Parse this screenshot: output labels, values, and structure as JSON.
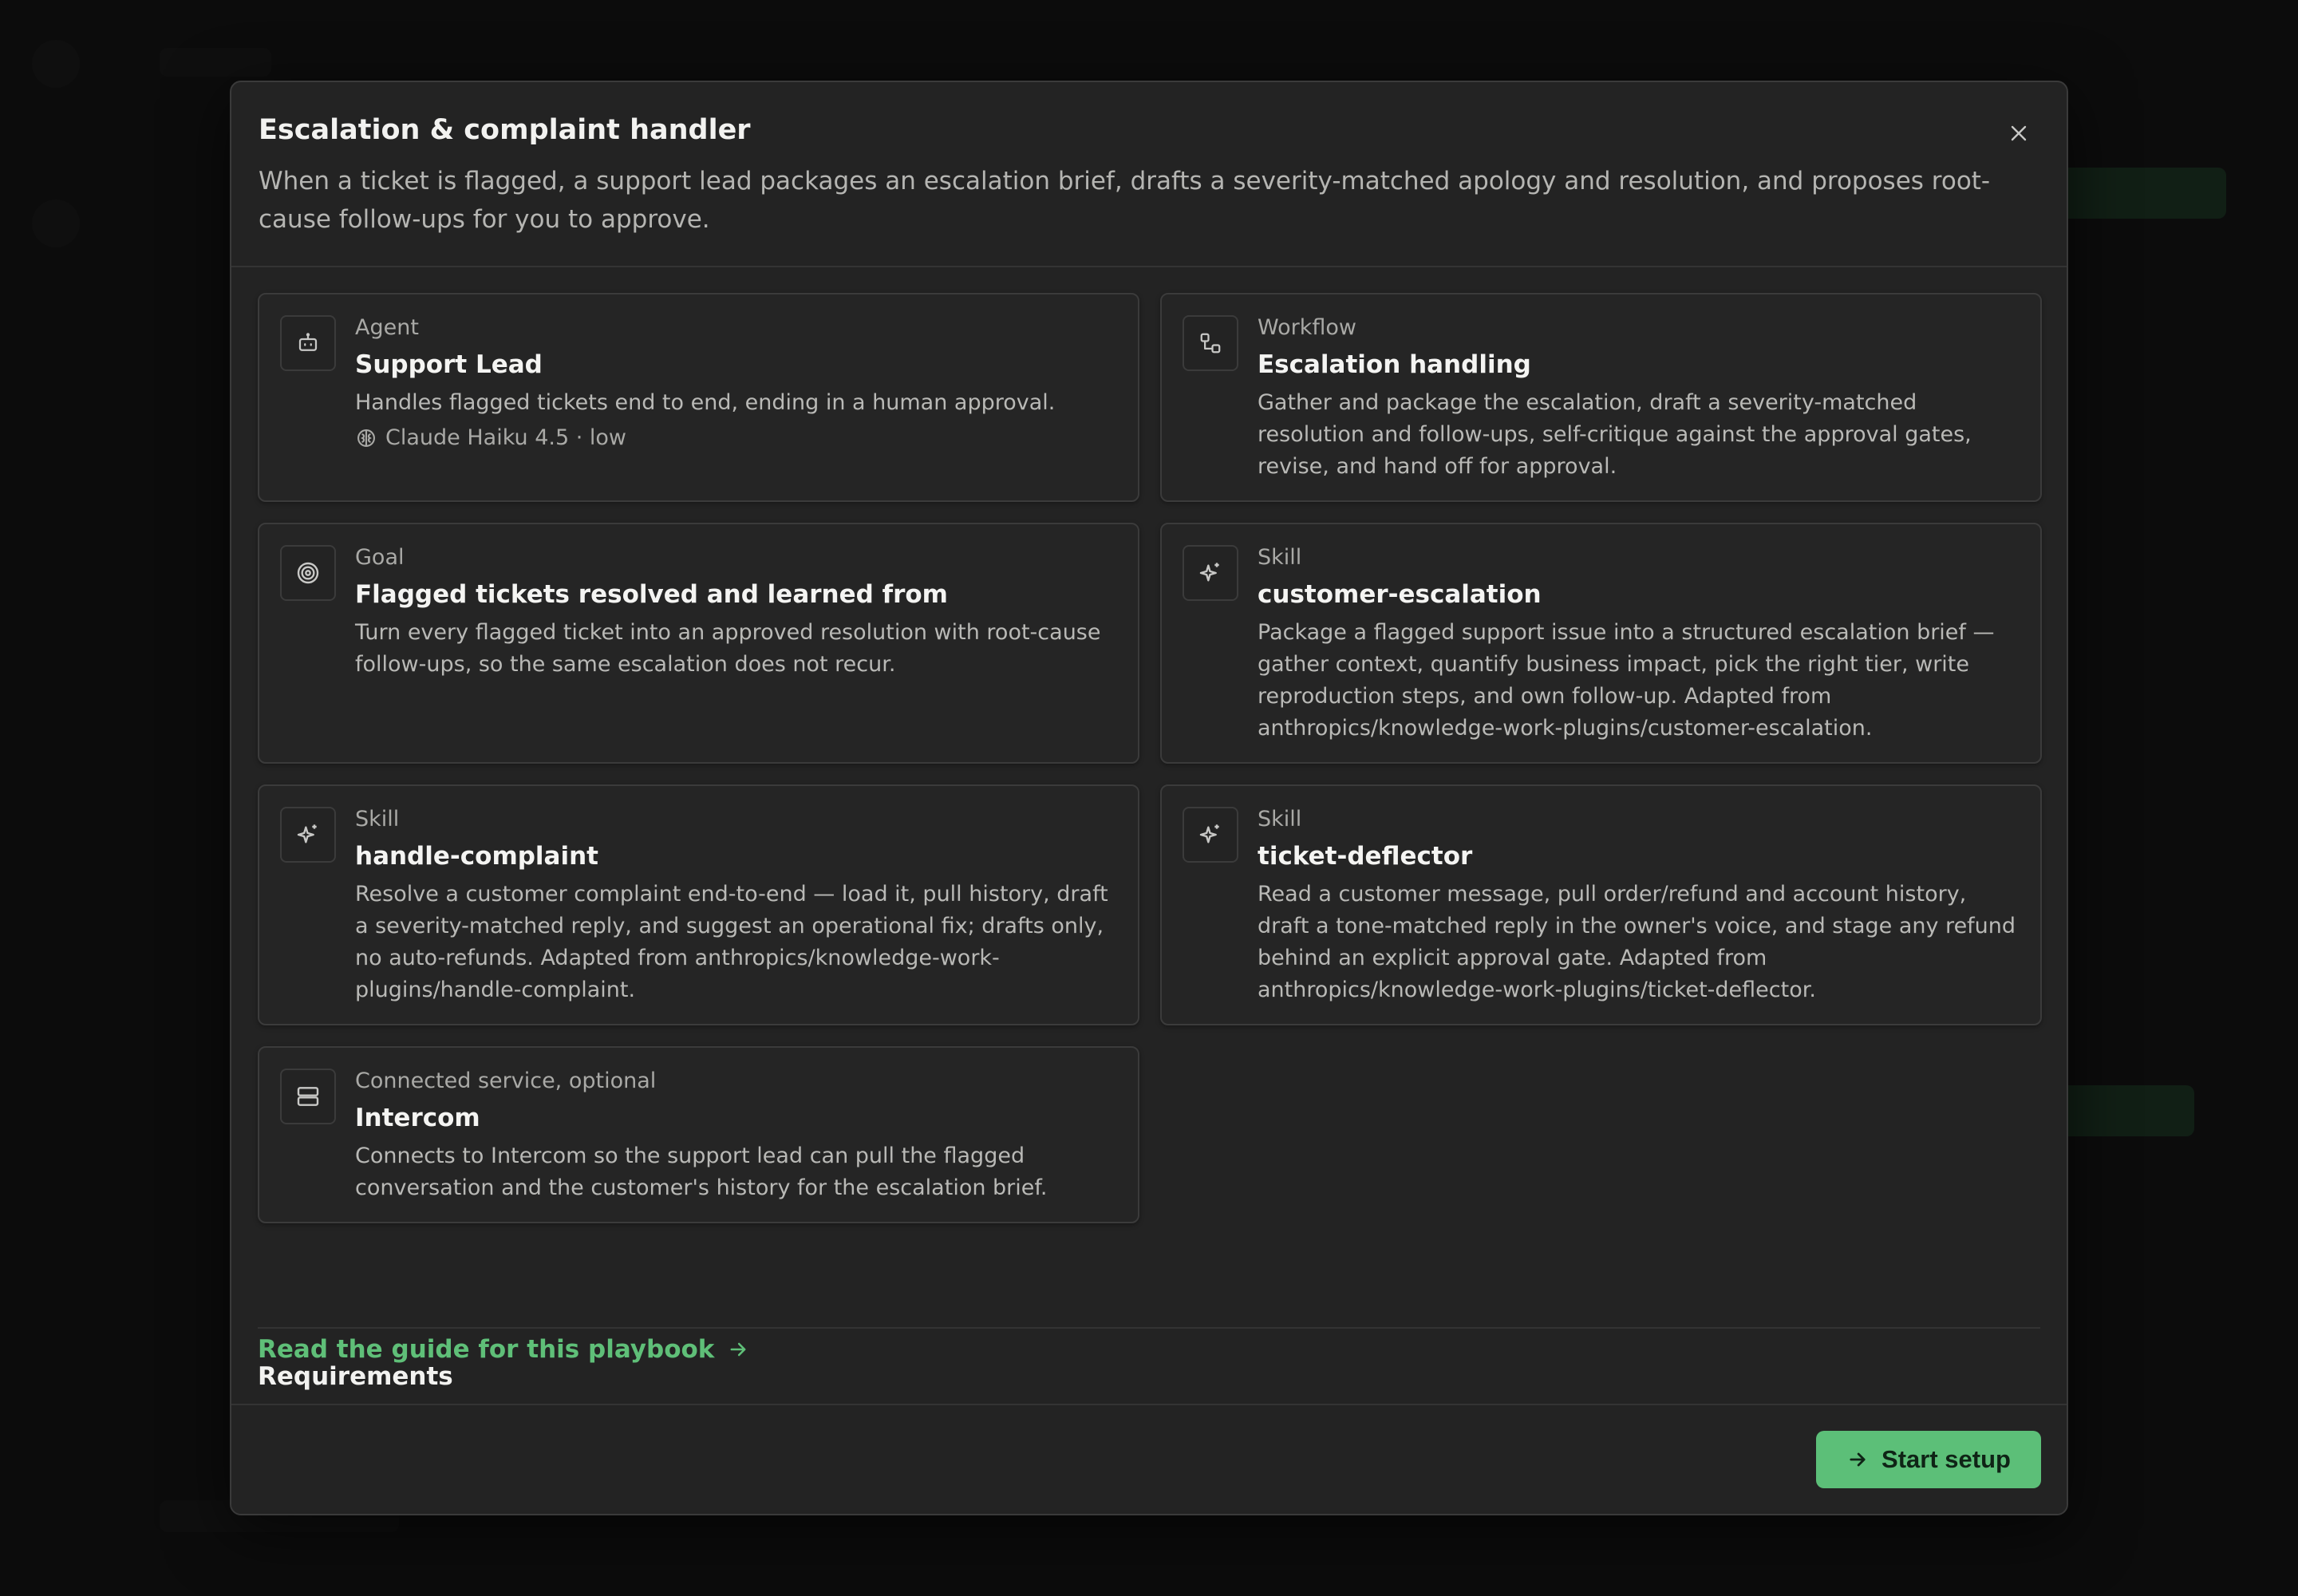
{
  "modal": {
    "title": "Escalation & complaint handler",
    "description": "When a ticket is flagged, a support lead packages an escalation brief, drafts a severity-matched apology and resolution, and proposes root-cause follow-ups for you to approve."
  },
  "cards": [
    {
      "icon": "robot-icon",
      "kind": "Agent",
      "name": "Support Lead",
      "text": "Handles flagged tickets end to end, ending in a human approval.",
      "model": "Claude Haiku 4.5 · low"
    },
    {
      "icon": "workflow-icon",
      "kind": "Workflow",
      "name": "Escalation handling",
      "text": "Gather and package the escalation, draft a severity-matched resolution and follow-ups, self-critique against the approval gates, revise, and hand off for approval."
    },
    {
      "icon": "target-icon",
      "kind": "Goal",
      "name": "Flagged tickets resolved and learned from",
      "text": "Turn every flagged ticket into an approved resolution with root-cause follow-ups, so the same escalation does not recur."
    },
    {
      "icon": "sparkle-icon",
      "kind": "Skill",
      "name": "customer-escalation",
      "text": "Package a flagged support issue into a structured escalation brief — gather context, quantify business impact, pick the right tier, write reproduction steps, and own follow-up. Adapted from anthropics/knowledge-work-plugins/customer-escalation."
    },
    {
      "icon": "sparkle-icon",
      "kind": "Skill",
      "name": "handle-complaint",
      "text": "Resolve a customer complaint end-to-end — load it, pull history, draft a severity-matched reply, and suggest an operational fix; drafts only, no auto-refunds. Adapted from anthropics/knowledge-work-plugins/handle-complaint."
    },
    {
      "icon": "sparkle-icon",
      "kind": "Skill",
      "name": "ticket-deflector",
      "text": "Read a customer message, pull order/refund and account history, draft a tone-matched reply in the owner's voice, and stage any refund behind an explicit approval gate. Adapted from anthropics/knowledge-work-plugins/ticket-deflector."
    },
    {
      "icon": "server-icon",
      "kind": "Connected service, optional",
      "name": "Intercom",
      "text": "Connects to Intercom so the support lead can pull the flagged conversation and the customer's history for the escalation brief."
    }
  ],
  "guide_link": "Read the guide for this playbook",
  "requirements_title": "Requirements",
  "start_button": "Start setup",
  "colors": {
    "accent": "#5cbf78",
    "background": "#232323"
  }
}
